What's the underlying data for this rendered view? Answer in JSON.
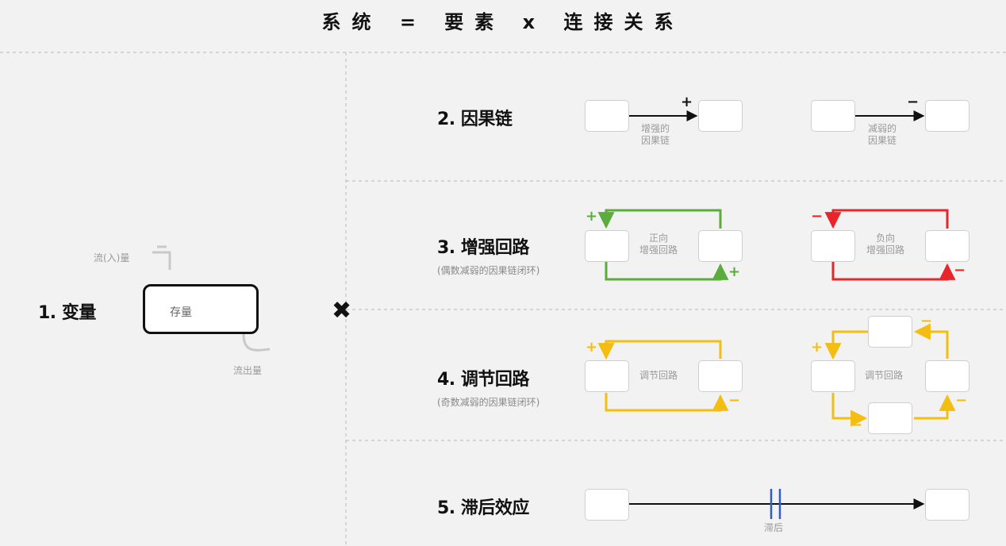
{
  "title": "系统 = 要素 x 连接关系",
  "variable": {
    "heading": "1. 变量",
    "stock_label": "存量",
    "inflow_label": "流(入)量",
    "outflow_label": "流出量"
  },
  "multiply_symbol": "✖",
  "causal_chain": {
    "heading": "2. 因果链",
    "reinforcing_label_1": "增强的",
    "reinforcing_label_2": "因果链",
    "reinforcing_sign": "+",
    "balancing_label_1": "减弱的",
    "balancing_label_2": "因果链",
    "balancing_sign": "−"
  },
  "reinforcing_loop": {
    "heading": "3. 增强回路",
    "note": "(偶数减弱的因果链闭环)",
    "positive_label_1": "正向",
    "positive_label_2": "增强回路",
    "negative_label_1": "负向",
    "negative_label_2": "增强回路",
    "plus": "+",
    "minus": "−"
  },
  "balancing_loop": {
    "heading": "4. 调节回路",
    "note": "(奇数减弱的因果链闭环)",
    "label_simple": "调节回路",
    "label_four": "调节回路",
    "plus": "+",
    "minus": "−"
  },
  "delay": {
    "heading": "5. 滞后效应",
    "label": "滞后"
  },
  "colors": {
    "green": "#5aac3c",
    "red": "#e8262a",
    "yellow": "#f4bd12",
    "blue": "#2f5bd3"
  }
}
